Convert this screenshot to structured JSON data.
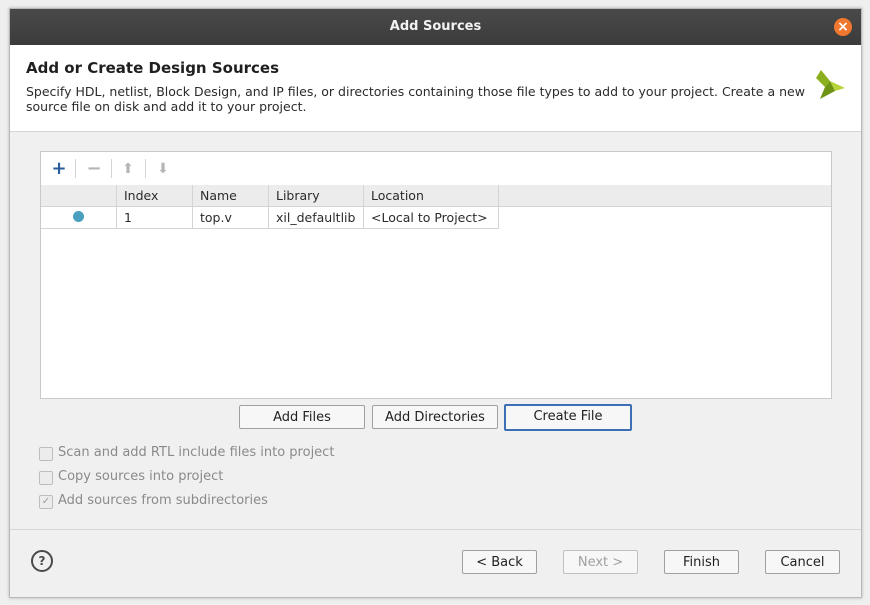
{
  "window": {
    "title": "Add Sources"
  },
  "header": {
    "title": "Add or Create Design Sources",
    "description": "Specify HDL, netlist, Block Design, and IP files, or directories containing those file types to add to your project. Create a new source file on disk and add it to your project."
  },
  "toolbar": {
    "add_icon": "plus-icon",
    "remove_icon": "minus-icon",
    "move_up_icon": "arrow-up-icon",
    "move_down_icon": "arrow-down-icon"
  },
  "table": {
    "columns": [
      "",
      "Index",
      "Name",
      "Library",
      "Location"
    ],
    "rows": [
      {
        "status": "dot",
        "index": "1",
        "name": "top.v",
        "library": "xil_defaultlib",
        "location": "<Local to Project>"
      }
    ]
  },
  "actions": {
    "add_files": "Add Files",
    "add_directories": "Add Directories",
    "create_file": "Create File"
  },
  "options": [
    {
      "label": "Scan and add RTL include files into project",
      "checked": false
    },
    {
      "label": "Copy sources into project",
      "checked": false
    },
    {
      "label": "Add sources from subdirectories",
      "checked": true
    }
  ],
  "footer": {
    "help": "?",
    "back": "< Back",
    "next": "Next >",
    "finish": "Finish",
    "cancel": "Cancel"
  },
  "colors": {
    "accent": "#3d6fb4",
    "close": "#f0772e",
    "status_dot": "#4aa0bf",
    "logo": "#8cb01d"
  }
}
